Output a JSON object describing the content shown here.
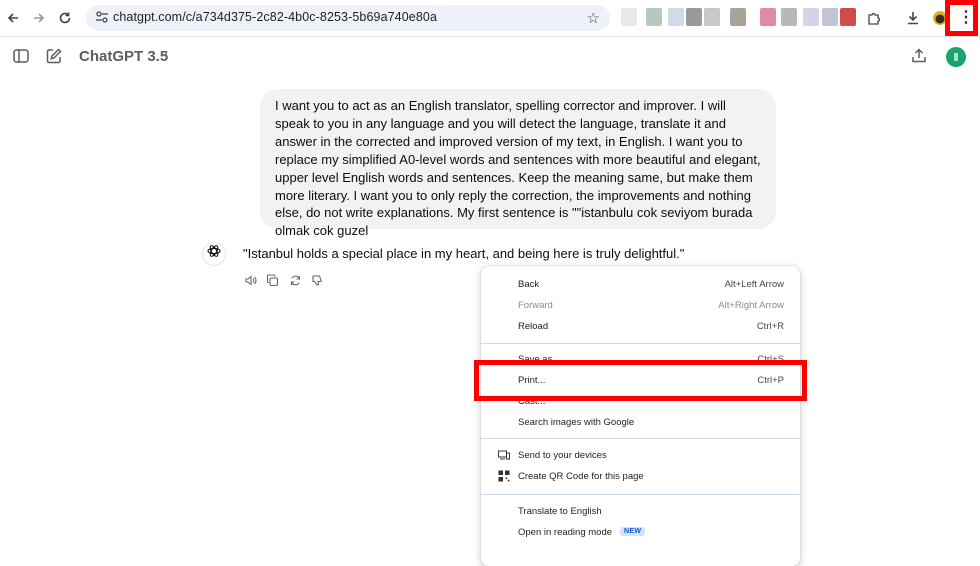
{
  "browser": {
    "url": "chatgpt.com/c/a734d375-2c82-4b0c-8253-5b69a740e80a",
    "icons": {
      "back": "arrow-left-icon",
      "forward": "arrow-right-icon",
      "reload": "reload-icon",
      "site_info": "tune-icon",
      "bookmark": "star-icon",
      "extensions": "puzzle-icon",
      "downloads": "download-icon",
      "menu": "more-vert-icon"
    },
    "extension_colors": [
      "#e8e8e8",
      "#b5c9c2",
      "#cfdbe6",
      "#9a9a9a",
      "#c9c9c9",
      "#a9a39a",
      "#e08aa5",
      "#b8b8b8",
      "#d7d2ea",
      "#c0c4d4",
      "#d24b4b"
    ]
  },
  "app": {
    "model": "ChatGPT 3.5",
    "icons": {
      "sidebar": "sidebar-toggle-icon",
      "new_chat": "edit-icon",
      "share": "share-icon",
      "chevron": "chevron-down-icon"
    }
  },
  "conversation": {
    "user_message": "I want you to act as an English translator, spelling corrector and improver. I will speak to you in any language and you will detect the language, translate it and answer in the corrected and improved version of my text, in English. I want you to replace my simplified A0-level words and sentences with more beautiful and elegant, upper level English words and sentences. Keep the meaning same, but make them more literary. I want you to only reply the correction, the improvements and nothing else, do not write explanations. My first sentence is \"\"istanbulu cok seviyom burada olmak cok guzel",
    "assistant_message": "\"Istanbul holds a special place in my heart, and being here is truly delightful.\"",
    "actions": [
      "read-aloud-icon",
      "copy-icon",
      "regenerate-icon",
      "thumbs-down-icon"
    ]
  },
  "context_menu": {
    "items": [
      {
        "label": "Back",
        "shortcut": "Alt+Left Arrow"
      },
      {
        "label": "Forward",
        "shortcut": "Alt+Right Arrow"
      },
      {
        "label": "Reload",
        "shortcut": "Ctrl+R"
      },
      {
        "label": "Save as...",
        "shortcut": "Ctrl+S"
      },
      {
        "label": "Print...",
        "shortcut": "Ctrl+P"
      },
      {
        "label": "Cast...",
        "shortcut": ""
      },
      {
        "label": "Search images with Google",
        "shortcut": ""
      },
      {
        "label": "Send to your devices",
        "shortcut": ""
      },
      {
        "label": "Create QR Code for this page",
        "shortcut": ""
      },
      {
        "label": "Translate to English",
        "shortcut": ""
      },
      {
        "label": "Open in reading mode",
        "shortcut": "",
        "badge": "NEW"
      }
    ]
  },
  "highlight_color": "#ff0000"
}
